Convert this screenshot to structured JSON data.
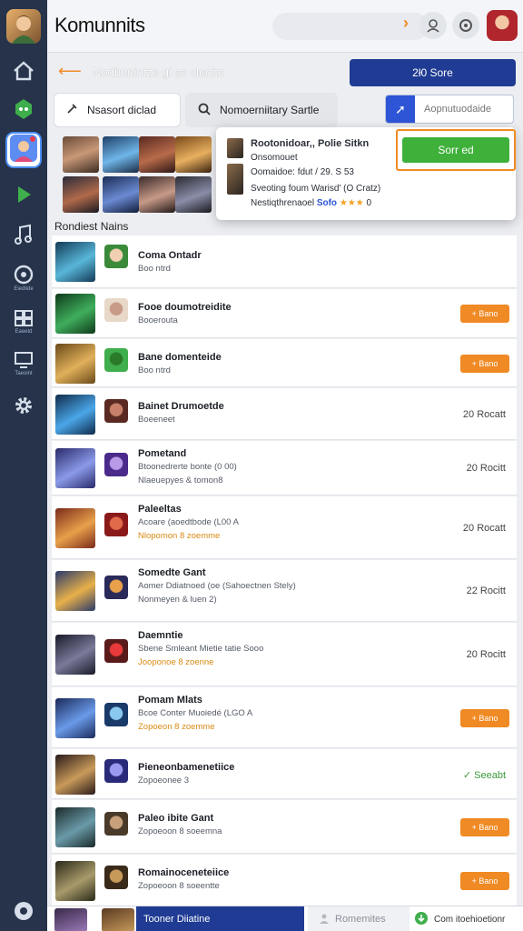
{
  "app": {
    "title": "Komunnits"
  },
  "header": {
    "back_icon": "arrow-left-icon",
    "title": "Nodbnnintze gl se clenite",
    "score_label": "2ł0 Sore"
  },
  "filters": {
    "chip1_label": "Nsasort diclad",
    "chip2_label": "Nomoerniitary Sartle",
    "search_placeholder": "Aopnutuodaide"
  },
  "popup": {
    "line1": "Rootonidoar,, Polie Sitkn",
    "line2": "Onsomouet",
    "line3": "Oomaidoe: fdut / 29. S 53",
    "line4": "Sveoting foum Warisd' (O Cratz)",
    "line5_prefix": "Nestiqthrenaoel",
    "line5_blue": "Sofo",
    "line5_stars": "★★★",
    "line5_suffix": "0",
    "search_label": "Sorr ed"
  },
  "section": {
    "label": "Rondiest Nains"
  },
  "rows": [
    {
      "title": "Coma Ontadr",
      "sub": "Boo ntrd",
      "sub2": "",
      "right": "",
      "right_type": "none"
    },
    {
      "title": "Fooe doumotreidite",
      "sub": "Booerouta",
      "sub2": "",
      "right": "+ Bano",
      "right_type": "tag"
    },
    {
      "title": "Bane domenteide",
      "sub": "Boo ntrd",
      "sub2": "",
      "right": "+ Bano",
      "right_type": "tag"
    },
    {
      "title": "Bainet Drumoetde",
      "sub": "Boeeneet",
      "sub2": "",
      "right": "20 Rocatt",
      "right_type": "text"
    },
    {
      "title": "Pometand",
      "sub": "Btoonedrerte bonte (0 00)",
      "sub2": "Nlaeuepyes & tomon8",
      "right": "20 Rocitt",
      "right_type": "text"
    },
    {
      "title": "Paleeltas",
      "sub": "Acoare (aoedtbode (L00 A",
      "sub2_a": "Nlopomon ",
      "sub2_b": "8 zoemme",
      "right": "20 Rocatt",
      "right_type": "text"
    },
    {
      "title": "Somedte Gant",
      "sub": "Aomer Ddiatnoed (oe (Sahoectnen Stely)",
      "sub2": "Nonmeyen & luen 2)",
      "right": "22 Rocitt",
      "right_type": "text"
    },
    {
      "title": "Daemntie",
      "sub": "Sbene Smleant Mietie tatie Sooo",
      "sub2_a": "Jooponoe ",
      "sub2_b": "8 zoenne",
      "right": "20 Rocitt",
      "right_type": "text"
    },
    {
      "title": "Pomam Mlats",
      "sub": "Bcoe Conter Muoiedé (LGO A",
      "sub2_a": "Zopoeon ",
      "sub2_b": "8 zoemme",
      "right": "+ Bano",
      "right_type": "tag"
    },
    {
      "title": "Pieneonbamenetiice",
      "sub": "Zopoeonee 3",
      "sub2": "",
      "right": "Seeabt",
      "right_type": "green"
    },
    {
      "title": "Paleo ibite Gant",
      "sub": "Zopoeoon 8 soeemna",
      "sub2": "",
      "right": "+ Bano",
      "right_type": "tag"
    },
    {
      "title": "Romainoceneteiice",
      "sub": "Zopoeoon 8 soeentte",
      "sub2": "",
      "right": "+ Bano",
      "right_type": "tag"
    }
  ],
  "bottom": {
    "tab1": "Tooner Diiatine",
    "tab2": "Romemites",
    "tab3": "Com itoehioetionr"
  },
  "sidebar": {
    "captions": [
      "Eiedlide",
      "Eaeetd",
      "Taeoint"
    ]
  }
}
